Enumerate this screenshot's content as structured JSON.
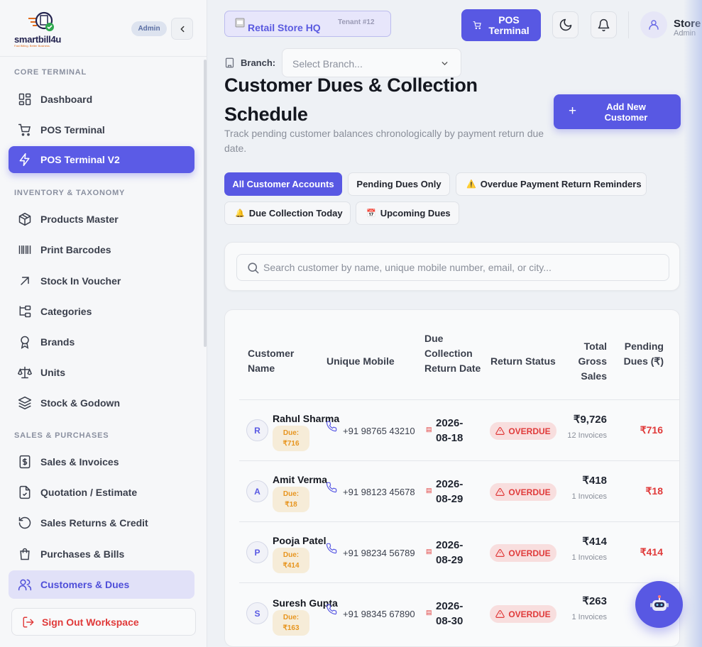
{
  "brand": {
    "name": "smartbill4u",
    "tagline": "Fast Billing. Better Business."
  },
  "sidebar": {
    "admin_badge": "Admin",
    "sections": [
      {
        "title": "CORE TERMINAL"
      },
      {
        "title": "INVENTORY & TAXONOMY"
      },
      {
        "title": "SALES & PURCHASES"
      }
    ],
    "items": [
      {
        "label": "Dashboard",
        "icon": "grid-icon"
      },
      {
        "label": "POS Terminal",
        "icon": "cart-icon"
      },
      {
        "label": "POS Terminal V2",
        "icon": "bolt-icon"
      },
      {
        "label": "Products Master",
        "icon": "box-icon"
      },
      {
        "label": "Print Barcodes",
        "icon": "barcode-icon"
      },
      {
        "label": "Stock In Voucher",
        "icon": "arrow-up-right-icon"
      },
      {
        "label": "Categories",
        "icon": "folder-tree-icon"
      },
      {
        "label": "Brands",
        "icon": "award-icon"
      },
      {
        "label": "Units",
        "icon": "scale-icon"
      },
      {
        "label": "Stock & Godown",
        "icon": "layers-icon"
      },
      {
        "label": "Sales & Invoices",
        "icon": "receipt-icon"
      },
      {
        "label": "Quotation / Estimate",
        "icon": "file-check-icon"
      },
      {
        "label": "Sales Returns & Credit",
        "icon": "rotate-ccw-icon"
      },
      {
        "label": "Purchases & Bills",
        "icon": "shopping-bag-icon"
      },
      {
        "label": "Customers & Dues",
        "icon": "users-icon"
      }
    ],
    "sign_out": "Sign Out Workspace"
  },
  "header": {
    "store_name": "Retail Store HQ",
    "tenant": "Tenant #12",
    "pos_button": "POS Terminal",
    "user_name": "Store",
    "user_role": "Admin"
  },
  "branch": {
    "label": "Branch:",
    "placeholder": "Select Branch..."
  },
  "page": {
    "title": "Customer Dues & Collection Schedule",
    "subtitle": "Track pending customer balances chronologically by payment return due date.",
    "add_button": "Add New Customer"
  },
  "filters": [
    {
      "label": "All Customer Accounts",
      "emoji": ""
    },
    {
      "label": "Pending Dues Only",
      "emoji": ""
    },
    {
      "label": "Overdue Payment Return Reminders",
      "emoji": "⚠️"
    },
    {
      "label": "Due Collection Today",
      "emoji": "🔔"
    },
    {
      "label": "Upcoming Dues",
      "emoji": "📅"
    }
  ],
  "search": {
    "placeholder": "Search customer by name, unique mobile number, email, or city..."
  },
  "table": {
    "headers": {
      "customer": "Customer Name",
      "mobile": "Unique Mobile",
      "due_date": "Due Collection Return Date",
      "status": "Return Status",
      "gross": "Total Gross Sales",
      "pending": "Pending Dues (₹)"
    },
    "rows": [
      {
        "initial": "R",
        "name": "Rahul Sharma",
        "due_prefix": "Due:",
        "due": "₹716",
        "mobile": "+91 98765 43210",
        "date": "2026-08-18",
        "status": "OVERDUE",
        "gross": "₹9,726",
        "invoices": "12 Invoices",
        "pending": "₹716"
      },
      {
        "initial": "A",
        "name": "Amit Verma",
        "due_prefix": "Due:",
        "due": "₹18",
        "mobile": "+91 98123 45678",
        "date": "2026-08-29",
        "status": "OVERDUE",
        "gross": "₹418",
        "invoices": "1 Invoices",
        "pending": "₹18"
      },
      {
        "initial": "P",
        "name": "Pooja Patel",
        "due_prefix": "Due:",
        "due": "₹414",
        "mobile": "+91 98234 56789",
        "date": "2026-08-29",
        "status": "OVERDUE",
        "gross": "₹414",
        "invoices": "1 Invoices",
        "pending": "₹414"
      },
      {
        "initial": "S",
        "name": "Suresh Gupta",
        "due_prefix": "Due:",
        "due": "₹163",
        "mobile": "+91 98345 67890",
        "date": "2026-08-30",
        "status": "OVERDUE",
        "gross": "₹263",
        "invoices": "1 Invoices",
        "pending": "₹163"
      }
    ]
  },
  "colors": {
    "accent": "#5858e3",
    "danger": "#e03a3a",
    "warning": "#e7951f"
  }
}
